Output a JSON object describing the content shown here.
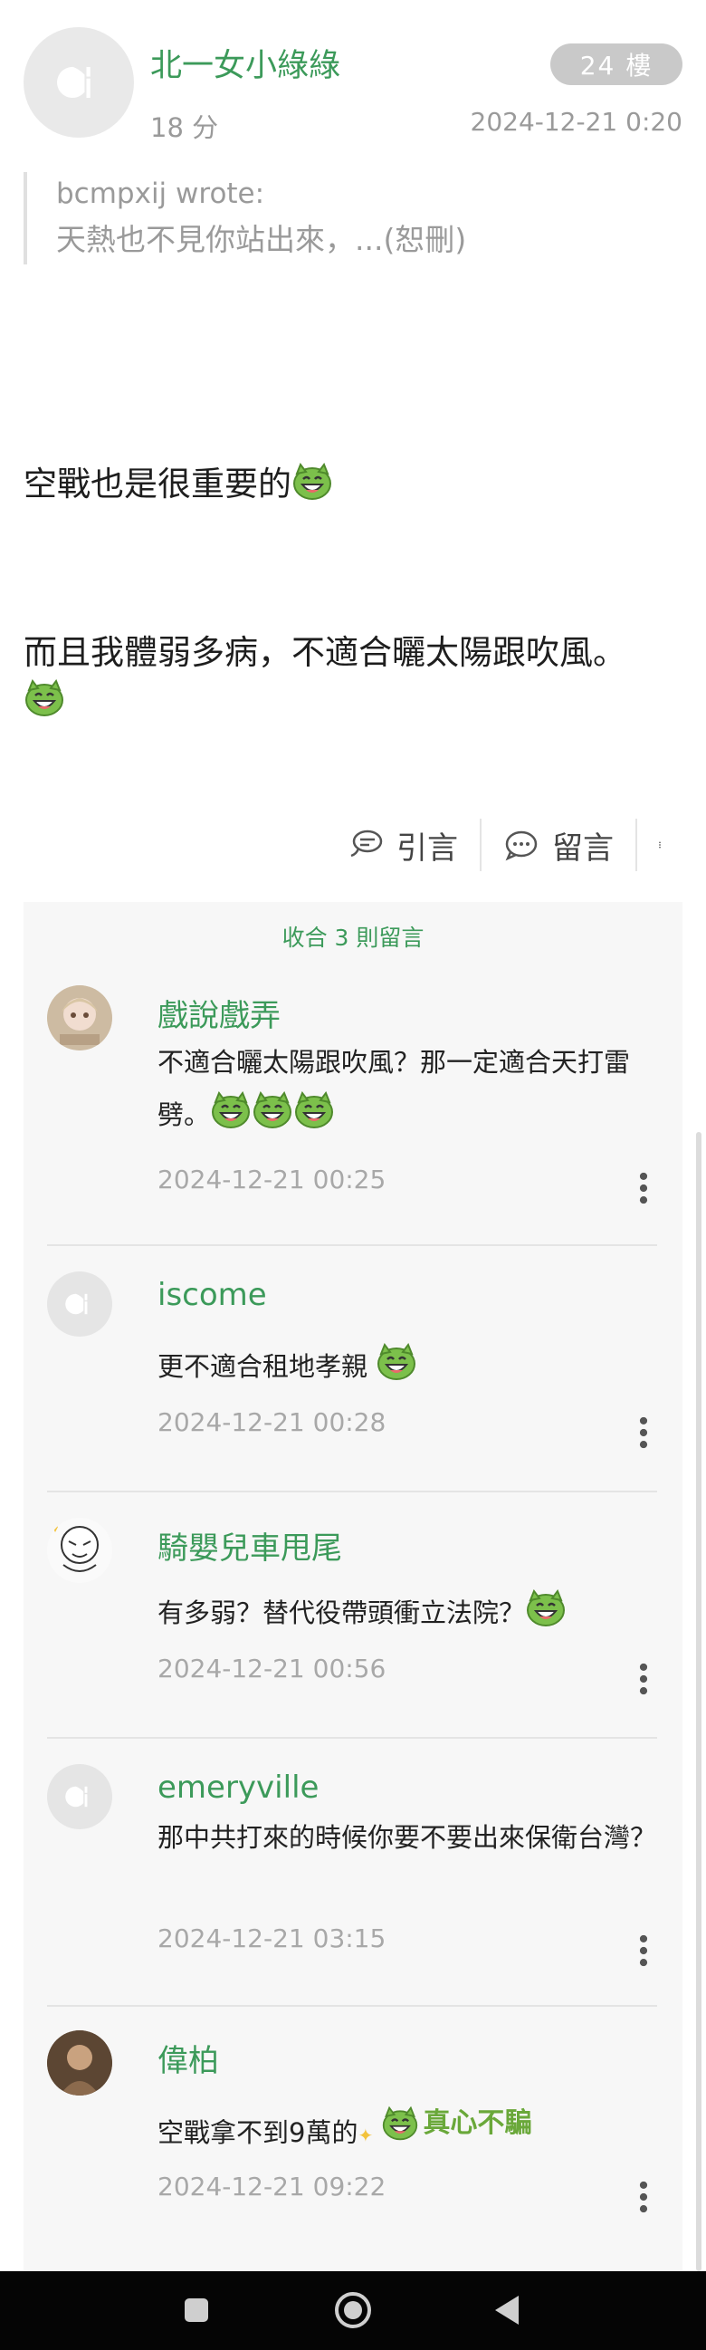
{
  "post": {
    "author": "北一女小綠綠",
    "floor": "24 樓",
    "relative_time": "18 分",
    "date": "2024-12-21 0:20",
    "quote": {
      "by": "bcmpxij wrote:",
      "text": "天熱也不見你站出來，...(恕刪)"
    },
    "lines": [
      "空戰也是很重要的",
      "而且我體弱多病，不適合曬太陽跟吹風。"
    ],
    "actions": {
      "quote_label": "引言",
      "comment_label": "留言"
    }
  },
  "comments": {
    "collapse_label": "收合 3 則留言",
    "items": [
      {
        "user": "戲說戲弄",
        "text": "不適合曬太陽跟吹風？那一定適合天打雷劈。",
        "date": "2024-12-21 00:25"
      },
      {
        "user": "iscome",
        "text": "更不適合租地孝親",
        "date": "2024-12-21 00:28"
      },
      {
        "user": "騎嬰兒車甩尾",
        "text": "有多弱？替代役帶頭衝立法院？",
        "date": "2024-12-21 00:56"
      },
      {
        "user": "emeryville",
        "text": "那中共打來的時候你要不要出來保衛台灣？",
        "date": "2024-12-21 03:15"
      },
      {
        "user": "偉柏",
        "text": "空戰拿不到9萬的",
        "sticker_text": "真心不騙",
        "date": "2024-12-21 09:22"
      }
    ]
  },
  "colors": {
    "accent": "#3c9a5a",
    "muted": "#9a9a9a",
    "badge": "#c9c9c9"
  },
  "icons": [
    "default-avatar-icon",
    "quote-icon",
    "comment-bubble-icon",
    "more-vertical-icon",
    "grin-emoji-icon",
    "sticker-icon",
    "nav-recents-icon",
    "nav-home-icon",
    "nav-back-icon"
  ]
}
